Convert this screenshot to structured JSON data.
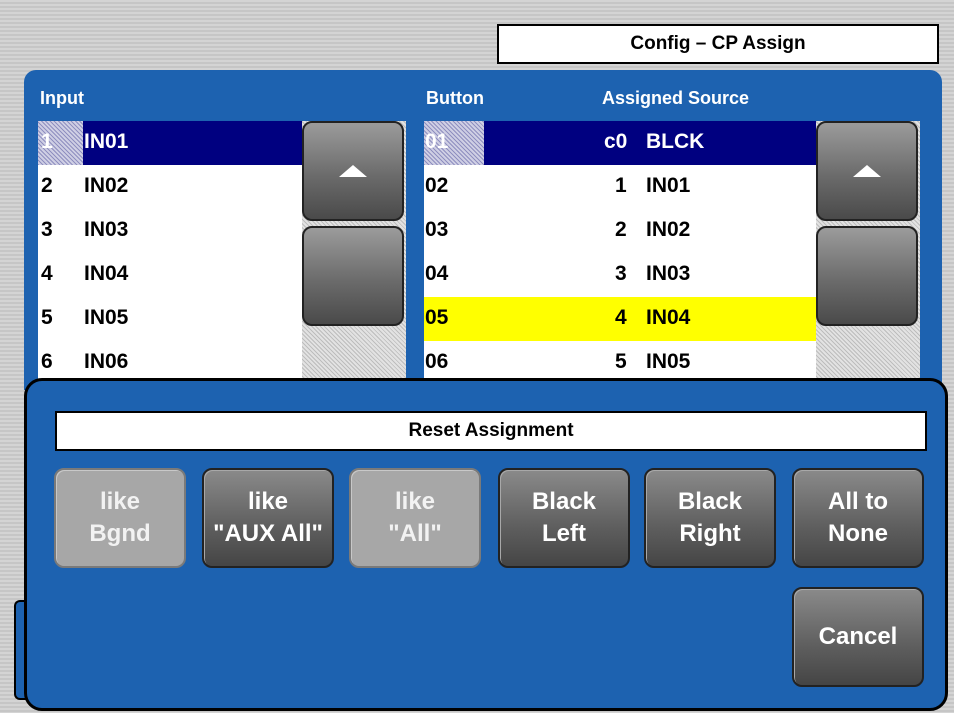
{
  "window_title": "Config – CP Assign",
  "input_panel": {
    "header": "Input",
    "rows": [
      {
        "num": "1",
        "name": "IN01"
      },
      {
        "num": "2",
        "name": "IN02"
      },
      {
        "num": "3",
        "name": "IN03"
      },
      {
        "num": "4",
        "name": "IN04"
      },
      {
        "num": "5",
        "name": "IN05"
      },
      {
        "num": "6",
        "name": "IN06"
      }
    ]
  },
  "button_panel": {
    "header_button": "Button",
    "header_source": "Assigned Source",
    "rows": [
      {
        "button": "01",
        "src_num": "c0",
        "src_name": "BLCK"
      },
      {
        "button": "02",
        "src_num": "1",
        "src_name": "IN01"
      },
      {
        "button": "03",
        "src_num": "2",
        "src_name": "IN02"
      },
      {
        "button": "04",
        "src_num": "3",
        "src_name": "IN03"
      },
      {
        "button": "05",
        "src_num": "4",
        "src_name": "IN04"
      },
      {
        "button": "06",
        "src_num": "5",
        "src_name": "IN05"
      }
    ]
  },
  "dialog": {
    "title": "Reset Assignment",
    "buttons": [
      {
        "line1": "like",
        "line2": "Bgnd",
        "enabled": false
      },
      {
        "line1": "like",
        "line2": "\"AUX All\"",
        "enabled": true
      },
      {
        "line1": "like",
        "line2": "\"All\"",
        "enabled": false
      },
      {
        "line1": "Black",
        "line2": "Left",
        "enabled": true
      },
      {
        "line1": "Black",
        "line2": "Right",
        "enabled": true
      },
      {
        "line1": "All to",
        "line2": "None",
        "enabled": true
      }
    ],
    "cancel": "Cancel"
  },
  "colors": {
    "panel_blue": "#1d62b0",
    "selection_navy": "#000080",
    "highlight_yellow": "#ffff00"
  },
  "icons": [
    "scroll-up-arrow-icon"
  ]
}
